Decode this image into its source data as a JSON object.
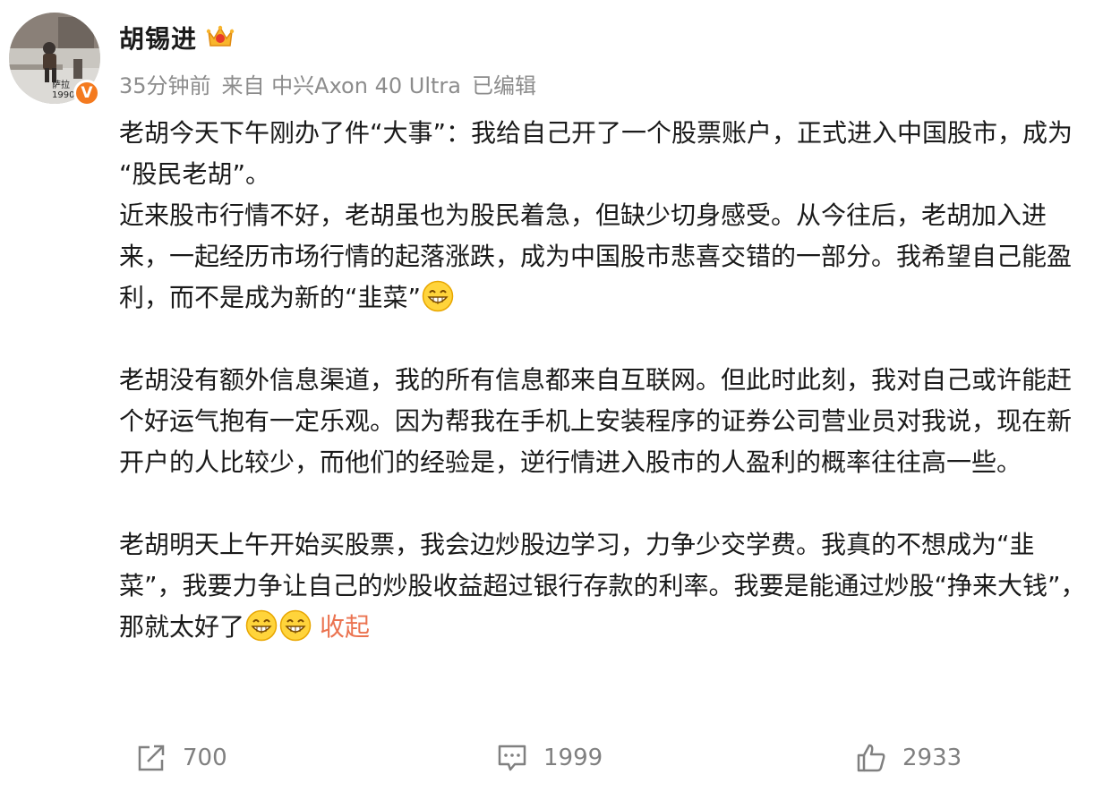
{
  "user": {
    "name": "胡锡进",
    "verified_badge": "V",
    "avatar_caption": "萨拉 1990"
  },
  "meta": {
    "time": "35分钟前",
    "source": "来自 中兴Axon 40 Ultra",
    "edited": "已编辑"
  },
  "post": {
    "p1": "老胡今天下午刚办了件“大事”：我给自己开了一个股票账户，正式进入中国股市，成为 “股民老胡”。",
    "p2": "近来股市行情不好，老胡虽也为股民着急，但缺少切身感受。从今往后，老胡加入进来，一起经历市场行情的起落涨跌，成为中国股市悲喜交错的一部分。我希望自己能盈利，而不是成为新的“韭菜”",
    "p3": "老胡没有额外信息渠道，我的所有信息都来自互联网。但此时此刻，我对自己或许能赶个好运气抱有一定乐观。因为帮我在手机上安装程序的证券公司营业员对我说，现在新开户的人比较少，而他们的经验是，逆行情进入股市的人盈利的概率往往高一些。",
    "p4": "老胡明天上午开始买股票，我会边炒股边学习，力争少交学费。我真的不想成为“韭菜”，我要力争让自己的炒股收益超过银行存款的利率。我要是能通过炒股“挣来大钱”，那就太好了",
    "collapse_label": "收起"
  },
  "actions": {
    "share_count": "700",
    "comment_count": "1999",
    "like_count": "2933"
  },
  "colors": {
    "link": "#eb7350",
    "meta": "#8c8c8c",
    "verified": "#f47a1f"
  },
  "icons": [
    "crown-icon",
    "grin-emoji-icon",
    "share-icon",
    "comment-icon",
    "like-icon"
  ]
}
